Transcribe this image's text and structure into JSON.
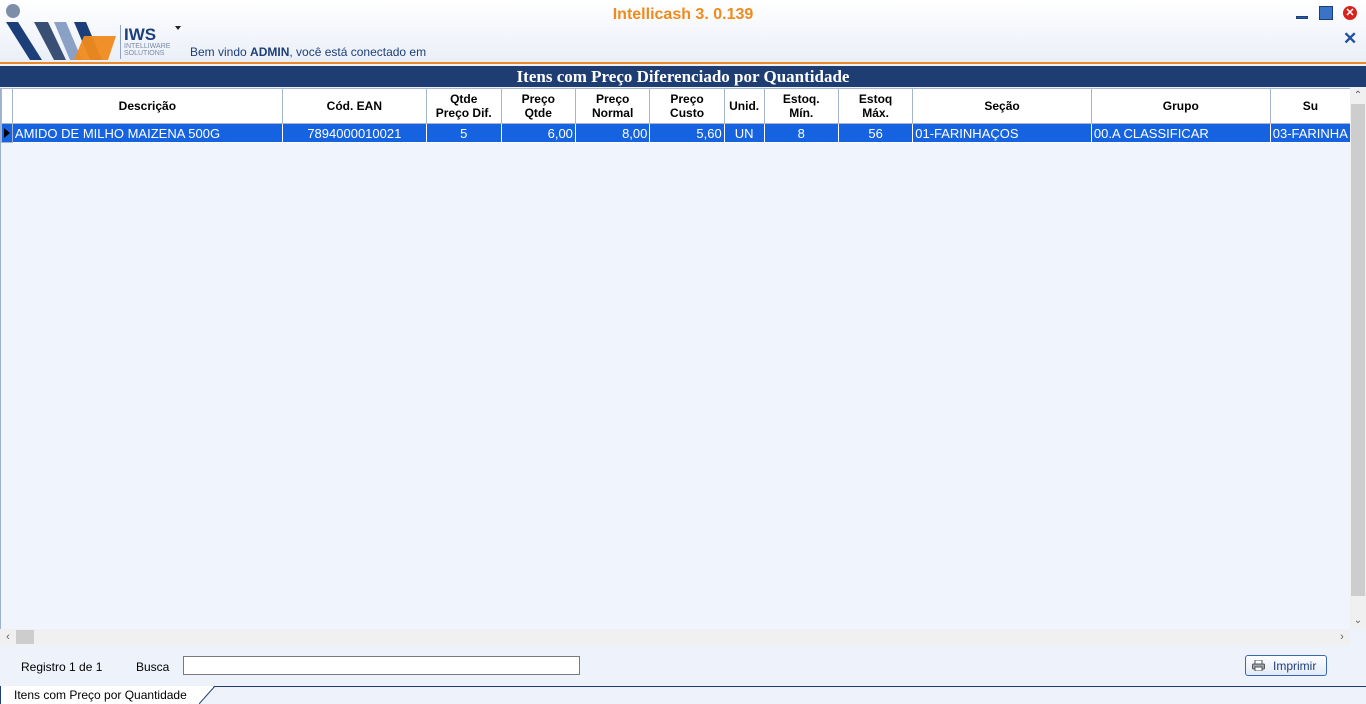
{
  "app": {
    "title": "Intellicash 3. 0.139",
    "logo_text": "IWS",
    "logo_sub": "INTELLIWARE SOLUTIONS",
    "welcome_prefix": "Bem vindo ",
    "welcome_user": "ADMIN",
    "welcome_suffix": ", você está conectado em"
  },
  "window_controls": [
    "minimize-icon",
    "maximize-icon",
    "close-icon",
    "close-form-icon"
  ],
  "form": {
    "title": "Itens com Preço Diferenciado por Quantidade"
  },
  "grid": {
    "columns": [
      {
        "line1": "Descrição",
        "line2": ""
      },
      {
        "line1": "Cód. EAN",
        "line2": ""
      },
      {
        "line1": "Qtde",
        "line2": "Preço Dif."
      },
      {
        "line1": "Preço",
        "line2": "Qtde"
      },
      {
        "line1": "Preço",
        "line2": "Normal"
      },
      {
        "line1": "Preço",
        "line2": "Custo"
      },
      {
        "line1": "Unid.",
        "line2": ""
      },
      {
        "line1": "Estoq.",
        "line2": "Mín."
      },
      {
        "line1": "Estoq",
        "line2": "Máx."
      },
      {
        "line1": "Seção",
        "line2": ""
      },
      {
        "line1": "Grupo",
        "line2": ""
      },
      {
        "line1": "Su",
        "line2": ""
      }
    ],
    "rows": [
      [
        "AMIDO DE MILHO MAIZENA 500G",
        "7894000010021",
        "5",
        "6,00",
        "8,00",
        "5,60",
        "UN",
        "8",
        "56",
        "01-FARINHAÇOS",
        "00.A CLASSIFICAR",
        "03-FARINHA"
      ]
    ],
    "selected_row": 0
  },
  "footer": {
    "registro": "Registro 1 de 1",
    "busca_label": "Busca",
    "busca_value": "",
    "print_label": "Imprimir"
  },
  "tabs": [
    {
      "label": "Itens com Preço por Quantidade"
    }
  ],
  "colors": {
    "header_bar": "#1e3d73",
    "accent_orange": "#f08a1c",
    "selection": "#1563e0"
  }
}
